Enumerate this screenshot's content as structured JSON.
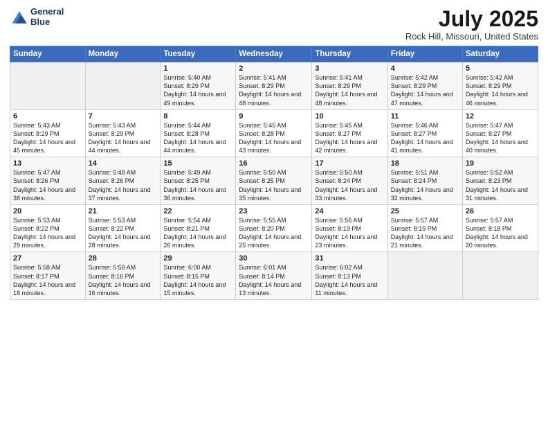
{
  "header": {
    "logo_line1": "General",
    "logo_line2": "Blue",
    "month": "July 2025",
    "location": "Rock Hill, Missouri, United States"
  },
  "weekdays": [
    "Sunday",
    "Monday",
    "Tuesday",
    "Wednesday",
    "Thursday",
    "Friday",
    "Saturday"
  ],
  "weeks": [
    [
      {
        "day": "",
        "text": ""
      },
      {
        "day": "",
        "text": ""
      },
      {
        "day": "1",
        "text": "Sunrise: 5:40 AM\nSunset: 8:29 PM\nDaylight: 14 hours and 49 minutes."
      },
      {
        "day": "2",
        "text": "Sunrise: 5:41 AM\nSunset: 8:29 PM\nDaylight: 14 hours and 48 minutes."
      },
      {
        "day": "3",
        "text": "Sunrise: 5:41 AM\nSunset: 8:29 PM\nDaylight: 14 hours and 48 minutes."
      },
      {
        "day": "4",
        "text": "Sunrise: 5:42 AM\nSunset: 8:29 PM\nDaylight: 14 hours and 47 minutes."
      },
      {
        "day": "5",
        "text": "Sunrise: 5:42 AM\nSunset: 8:29 PM\nDaylight: 14 hours and 46 minutes."
      }
    ],
    [
      {
        "day": "6",
        "text": "Sunrise: 5:43 AM\nSunset: 8:29 PM\nDaylight: 14 hours and 45 minutes."
      },
      {
        "day": "7",
        "text": "Sunrise: 5:43 AM\nSunset: 8:29 PM\nDaylight: 14 hours and 44 minutes."
      },
      {
        "day": "8",
        "text": "Sunrise: 5:44 AM\nSunset: 8:28 PM\nDaylight: 14 hours and 44 minutes."
      },
      {
        "day": "9",
        "text": "Sunrise: 5:45 AM\nSunset: 8:28 PM\nDaylight: 14 hours and 43 minutes."
      },
      {
        "day": "10",
        "text": "Sunrise: 5:45 AM\nSunset: 8:27 PM\nDaylight: 14 hours and 42 minutes."
      },
      {
        "day": "11",
        "text": "Sunrise: 5:46 AM\nSunset: 8:27 PM\nDaylight: 14 hours and 41 minutes."
      },
      {
        "day": "12",
        "text": "Sunrise: 5:47 AM\nSunset: 8:27 PM\nDaylight: 14 hours and 40 minutes."
      }
    ],
    [
      {
        "day": "13",
        "text": "Sunrise: 5:47 AM\nSunset: 8:26 PM\nDaylight: 14 hours and 38 minutes."
      },
      {
        "day": "14",
        "text": "Sunrise: 5:48 AM\nSunset: 8:26 PM\nDaylight: 14 hours and 37 minutes."
      },
      {
        "day": "15",
        "text": "Sunrise: 5:49 AM\nSunset: 8:25 PM\nDaylight: 14 hours and 36 minutes."
      },
      {
        "day": "16",
        "text": "Sunrise: 5:50 AM\nSunset: 8:25 PM\nDaylight: 14 hours and 35 minutes."
      },
      {
        "day": "17",
        "text": "Sunrise: 5:50 AM\nSunset: 8:24 PM\nDaylight: 14 hours and 33 minutes."
      },
      {
        "day": "18",
        "text": "Sunrise: 5:51 AM\nSunset: 8:24 PM\nDaylight: 14 hours and 32 minutes."
      },
      {
        "day": "19",
        "text": "Sunrise: 5:52 AM\nSunset: 8:23 PM\nDaylight: 14 hours and 31 minutes."
      }
    ],
    [
      {
        "day": "20",
        "text": "Sunrise: 5:53 AM\nSunset: 8:22 PM\nDaylight: 14 hours and 29 minutes."
      },
      {
        "day": "21",
        "text": "Sunrise: 5:53 AM\nSunset: 8:22 PM\nDaylight: 14 hours and 28 minutes."
      },
      {
        "day": "22",
        "text": "Sunrise: 5:54 AM\nSunset: 8:21 PM\nDaylight: 14 hours and 26 minutes."
      },
      {
        "day": "23",
        "text": "Sunrise: 5:55 AM\nSunset: 8:20 PM\nDaylight: 14 hours and 25 minutes."
      },
      {
        "day": "24",
        "text": "Sunrise: 5:56 AM\nSunset: 8:19 PM\nDaylight: 14 hours and 23 minutes."
      },
      {
        "day": "25",
        "text": "Sunrise: 5:57 AM\nSunset: 8:19 PM\nDaylight: 14 hours and 21 minutes."
      },
      {
        "day": "26",
        "text": "Sunrise: 5:57 AM\nSunset: 8:18 PM\nDaylight: 14 hours and 20 minutes."
      }
    ],
    [
      {
        "day": "27",
        "text": "Sunrise: 5:58 AM\nSunset: 8:17 PM\nDaylight: 14 hours and 18 minutes."
      },
      {
        "day": "28",
        "text": "Sunrise: 5:59 AM\nSunset: 8:16 PM\nDaylight: 14 hours and 16 minutes."
      },
      {
        "day": "29",
        "text": "Sunrise: 6:00 AM\nSunset: 8:15 PM\nDaylight: 14 hours and 15 minutes."
      },
      {
        "day": "30",
        "text": "Sunrise: 6:01 AM\nSunset: 8:14 PM\nDaylight: 14 hours and 13 minutes."
      },
      {
        "day": "31",
        "text": "Sunrise: 6:02 AM\nSunset: 8:13 PM\nDaylight: 14 hours and 11 minutes."
      },
      {
        "day": "",
        "text": ""
      },
      {
        "day": "",
        "text": ""
      }
    ]
  ]
}
